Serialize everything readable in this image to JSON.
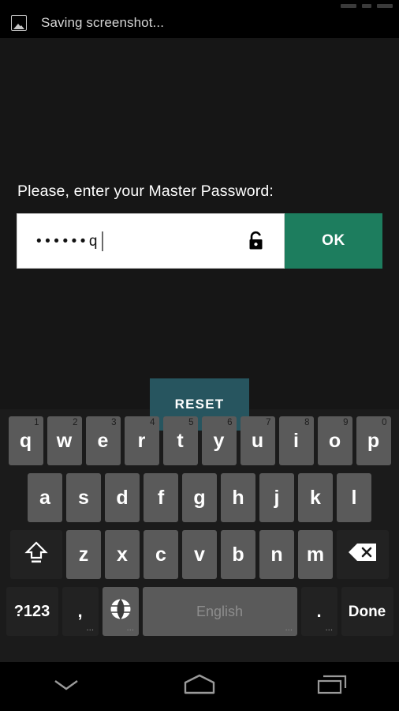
{
  "status_bar": {
    "icons": [
      "signal-icon",
      "wifi-icon",
      "battery-icon"
    ]
  },
  "notification": {
    "icon": "image-icon",
    "text": "Saving screenshot..."
  },
  "dialog": {
    "prompt": "Please, enter your Master Password:",
    "password_field": {
      "value": "••••••q",
      "placeholder": "",
      "trailing_icon": "unlock-icon"
    },
    "ok_label": "OK",
    "reset_label": "RESET",
    "ok_color": "#1d7d5e",
    "reset_color": "#27555f"
  },
  "keyboard": {
    "row1": [
      {
        "label": "q",
        "hint": "1"
      },
      {
        "label": "w",
        "hint": "2"
      },
      {
        "label": "e",
        "hint": "3"
      },
      {
        "label": "r",
        "hint": "4"
      },
      {
        "label": "t",
        "hint": "5"
      },
      {
        "label": "y",
        "hint": "6"
      },
      {
        "label": "u",
        "hint": "7"
      },
      {
        "label": "i",
        "hint": "8"
      },
      {
        "label": "o",
        "hint": "9"
      },
      {
        "label": "p",
        "hint": "0"
      }
    ],
    "row2": [
      {
        "label": "a"
      },
      {
        "label": "s"
      },
      {
        "label": "d"
      },
      {
        "label": "f"
      },
      {
        "label": "g"
      },
      {
        "label": "h"
      },
      {
        "label": "j"
      },
      {
        "label": "k"
      },
      {
        "label": "l"
      }
    ],
    "row3": {
      "shift": "shift-icon",
      "letters": [
        {
          "label": "z"
        },
        {
          "label": "x"
        },
        {
          "label": "c"
        },
        {
          "label": "v"
        },
        {
          "label": "b"
        },
        {
          "label": "n"
        },
        {
          "label": "m"
        }
      ],
      "backspace": "backspace-icon"
    },
    "row4": {
      "symbols_label": "?123",
      "comma_label": ",",
      "comma_hint": "···",
      "globe_icon": "globe-icon",
      "globe_hint": "···",
      "space_label": "English",
      "space_hint": "···",
      "period_label": ".",
      "period_hint": "···",
      "done_label": "Done"
    }
  },
  "navbar": {
    "back": "chevron-down-icon",
    "home": "home-icon",
    "recents": "recents-icon"
  }
}
